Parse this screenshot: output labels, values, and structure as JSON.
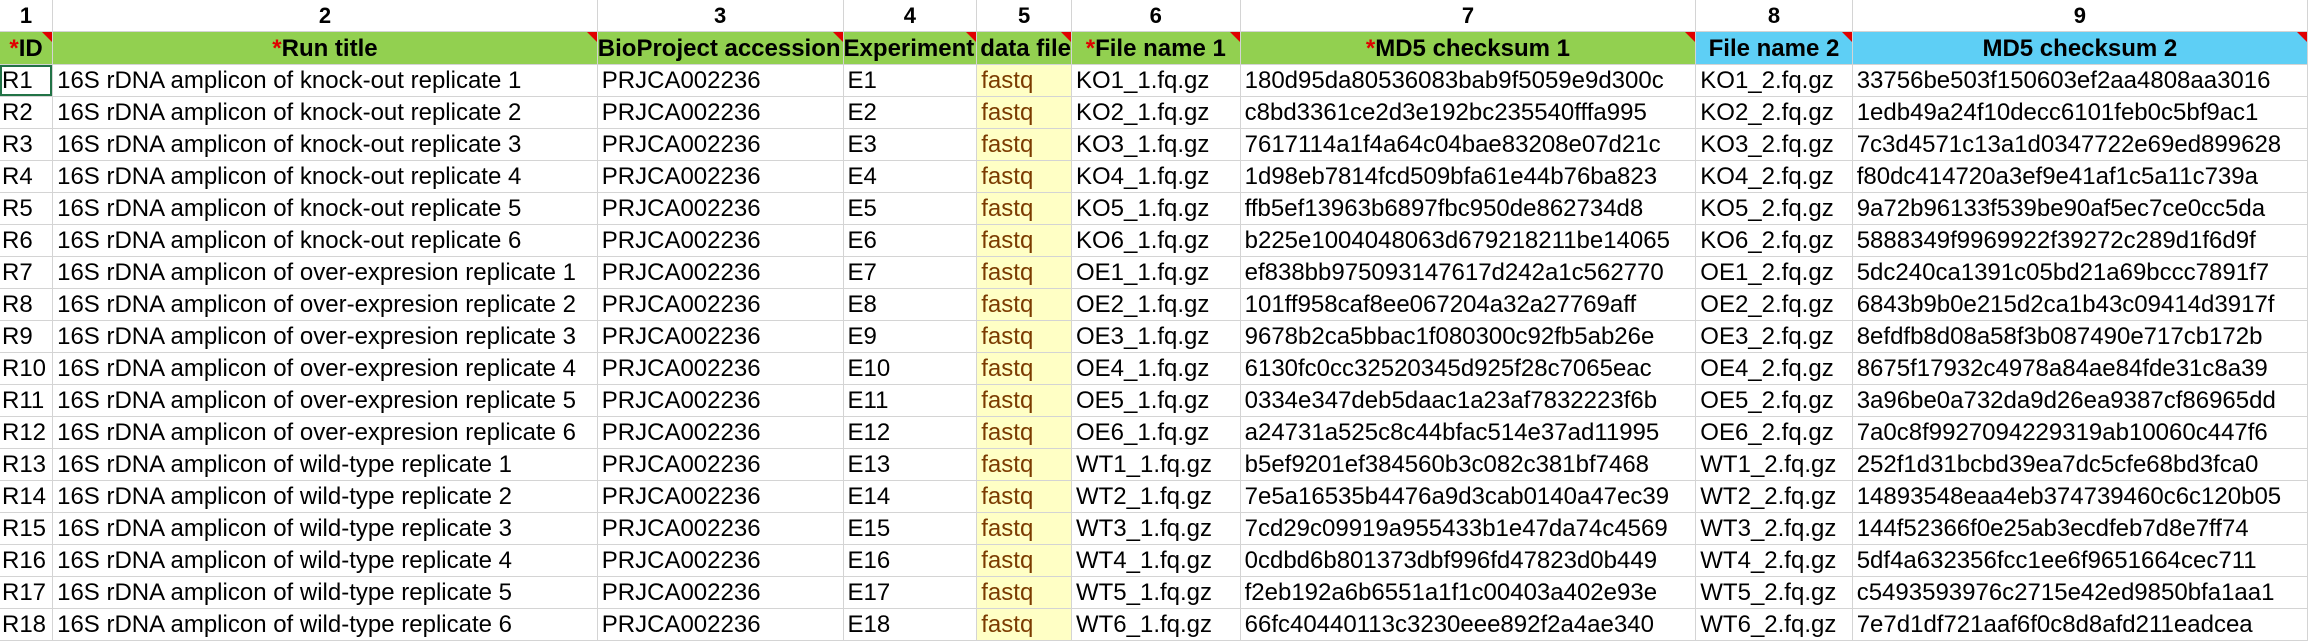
{
  "column_numbers": [
    "1",
    "2",
    "3",
    "4",
    "5",
    "6",
    "7",
    "8",
    "9"
  ],
  "headers": [
    {
      "required": true,
      "label": "ID"
    },
    {
      "required": true,
      "label": "Run title"
    },
    {
      "required": false,
      "label": "BioProject accession"
    },
    {
      "required": false,
      "label": "Experiment"
    },
    {
      "required": false,
      "label": "data file"
    },
    {
      "required": true,
      "label": "File name 1"
    },
    {
      "required": true,
      "label": "MD5 checksum 1"
    },
    {
      "required": false,
      "label": "File name 2"
    },
    {
      "required": false,
      "label": "MD5 checksum 2"
    }
  ],
  "required_marker": "*",
  "colors": {
    "required_header": "#92d050",
    "optional_header": "#5ecff5",
    "filetype_column": "#ffffc5",
    "note_marker": "#e00000"
  },
  "rows": [
    [
      "R1",
      "16S rDNA amplicon of knock-out replicate 1",
      "PRJCA002236",
      "E1",
      "fastq",
      "KO1_1.fq.gz",
      "180d95da80536083bab9f5059e9d300c",
      "KO1_2.fq.gz",
      "33756be503f150603ef2aa4808aa3016"
    ],
    [
      "R2",
      "16S rDNA amplicon of knock-out replicate 2",
      "PRJCA002236",
      "E2",
      "fastq",
      "KO2_1.fq.gz",
      "c8bd3361ce2d3e192bc235540fffa995",
      "KO2_2.fq.gz",
      "1edb49a24f10decc6101feb0c5bf9ac1"
    ],
    [
      "R3",
      "16S rDNA amplicon of knock-out replicate 3",
      "PRJCA002236",
      "E3",
      "fastq",
      "KO3_1.fq.gz",
      "7617114a1f4a64c04bae83208e07d21c",
      "KO3_2.fq.gz",
      "7c3d4571c13a1d0347722e69ed899628"
    ],
    [
      "R4",
      "16S rDNA amplicon of knock-out replicate 4",
      "PRJCA002236",
      "E4",
      "fastq",
      "KO4_1.fq.gz",
      "1d98eb7814fcd509bfa61e44b76ba823",
      "KO4_2.fq.gz",
      "f80dc414720a3ef9e41af1c5a11c739a"
    ],
    [
      "R5",
      "16S rDNA amplicon of knock-out replicate 5",
      "PRJCA002236",
      "E5",
      "fastq",
      "KO5_1.fq.gz",
      "ffb5ef13963b6897fbc950de862734d8",
      "KO5_2.fq.gz",
      "9a72b96133f539be90af5ec7ce0cc5da"
    ],
    [
      "R6",
      "16S rDNA amplicon of knock-out replicate 6",
      "PRJCA002236",
      "E6",
      "fastq",
      "KO6_1.fq.gz",
      "b225e1004048063d679218211be14065",
      "KO6_2.fq.gz",
      "5888349f9969922f39272c289d1f6d9f"
    ],
    [
      "R7",
      "16S rDNA amplicon of over-expresion replicate 1",
      "PRJCA002236",
      "E7",
      "fastq",
      "OE1_1.fq.gz",
      "ef838bb975093147617d242a1c562770",
      "OE1_2.fq.gz",
      "5dc240ca1391c05bd21a69bccc7891f7"
    ],
    [
      "R8",
      "16S rDNA amplicon of over-expresion replicate 2",
      "PRJCA002236",
      "E8",
      "fastq",
      "OE2_1.fq.gz",
      "101ff958caf8ee067204a32a27769aff",
      "OE2_2.fq.gz",
      "6843b9b0e215d2ca1b43c09414d3917f"
    ],
    [
      "R9",
      "16S rDNA amplicon of over-expresion replicate 3",
      "PRJCA002236",
      "E9",
      "fastq",
      "OE3_1.fq.gz",
      "9678b2ca5bbac1f080300c92fb5ab26e",
      "OE3_2.fq.gz",
      "8efdfb8d08a58f3b087490e717cb172b"
    ],
    [
      "R10",
      "16S rDNA amplicon of over-expresion replicate 4",
      "PRJCA002236",
      "E10",
      "fastq",
      "OE4_1.fq.gz",
      "6130fc0cc32520345d925f28c7065eac",
      "OE4_2.fq.gz",
      "8675f17932c4978a84ae84fde31c8a39"
    ],
    [
      "R11",
      "16S rDNA amplicon of over-expresion replicate 5",
      "PRJCA002236",
      "E11",
      "fastq",
      "OE5_1.fq.gz",
      "0334e347deb5daac1a23af7832223f6b",
      "OE5_2.fq.gz",
      "3a96be0a732da9d26ea9387cf86965dd"
    ],
    [
      "R12",
      "16S rDNA amplicon of over-expresion replicate 6",
      "PRJCA002236",
      "E12",
      "fastq",
      "OE6_1.fq.gz",
      "a24731a525c8c44bfac514e37ad11995",
      "OE6_2.fq.gz",
      "7a0c8f9927094229319ab10060c447f6"
    ],
    [
      "R13",
      "16S rDNA amplicon of wild-type replicate 1",
      "PRJCA002236",
      "E13",
      "fastq",
      "WT1_1.fq.gz",
      "b5ef9201ef384560b3c082c381bf7468",
      "WT1_2.fq.gz",
      "252f1d31bcbd39ea7dc5cfe68bd3fca0"
    ],
    [
      "R14",
      "16S rDNA amplicon of wild-type replicate 2",
      "PRJCA002236",
      "E14",
      "fastq",
      "WT2_1.fq.gz",
      "7e5a16535b4476a9d3cab0140a47ec39",
      "WT2_2.fq.gz",
      "14893548eaa4eb374739460c6c120b05"
    ],
    [
      "R15",
      "16S rDNA amplicon of wild-type replicate 3",
      "PRJCA002236",
      "E15",
      "fastq",
      "WT3_1.fq.gz",
      "7cd29c09919a955433b1e47da74c4569",
      "WT3_2.fq.gz",
      "144f52366f0e25ab3ecdfeb7d8e7ff74"
    ],
    [
      "R16",
      "16S rDNA amplicon of wild-type replicate 4",
      "PRJCA002236",
      "E16",
      "fastq",
      "WT4_1.fq.gz",
      "0cdbd6b801373dbf996fd47823d0b449",
      "WT4_2.fq.gz",
      "5df4a632356fcc1ee6f9651664cec711"
    ],
    [
      "R17",
      "16S rDNA amplicon of wild-type replicate 5",
      "PRJCA002236",
      "E17",
      "fastq",
      "WT5_1.fq.gz",
      "f2eb192a6b6551a1f1c00403a402e93e",
      "WT5_2.fq.gz",
      "c5493593976c2715e42ed9850bfa1aa1"
    ],
    [
      "R18",
      "16S rDNA amplicon of wild-type replicate 6",
      "PRJCA002236",
      "E18",
      "fastq",
      "WT6_1.fq.gz",
      "66fc40440113c3230eee892f2a4ae340",
      "WT6_2.fq.gz",
      "7e7d1df721aaf6f0c8d8afd211eadcea"
    ]
  ]
}
